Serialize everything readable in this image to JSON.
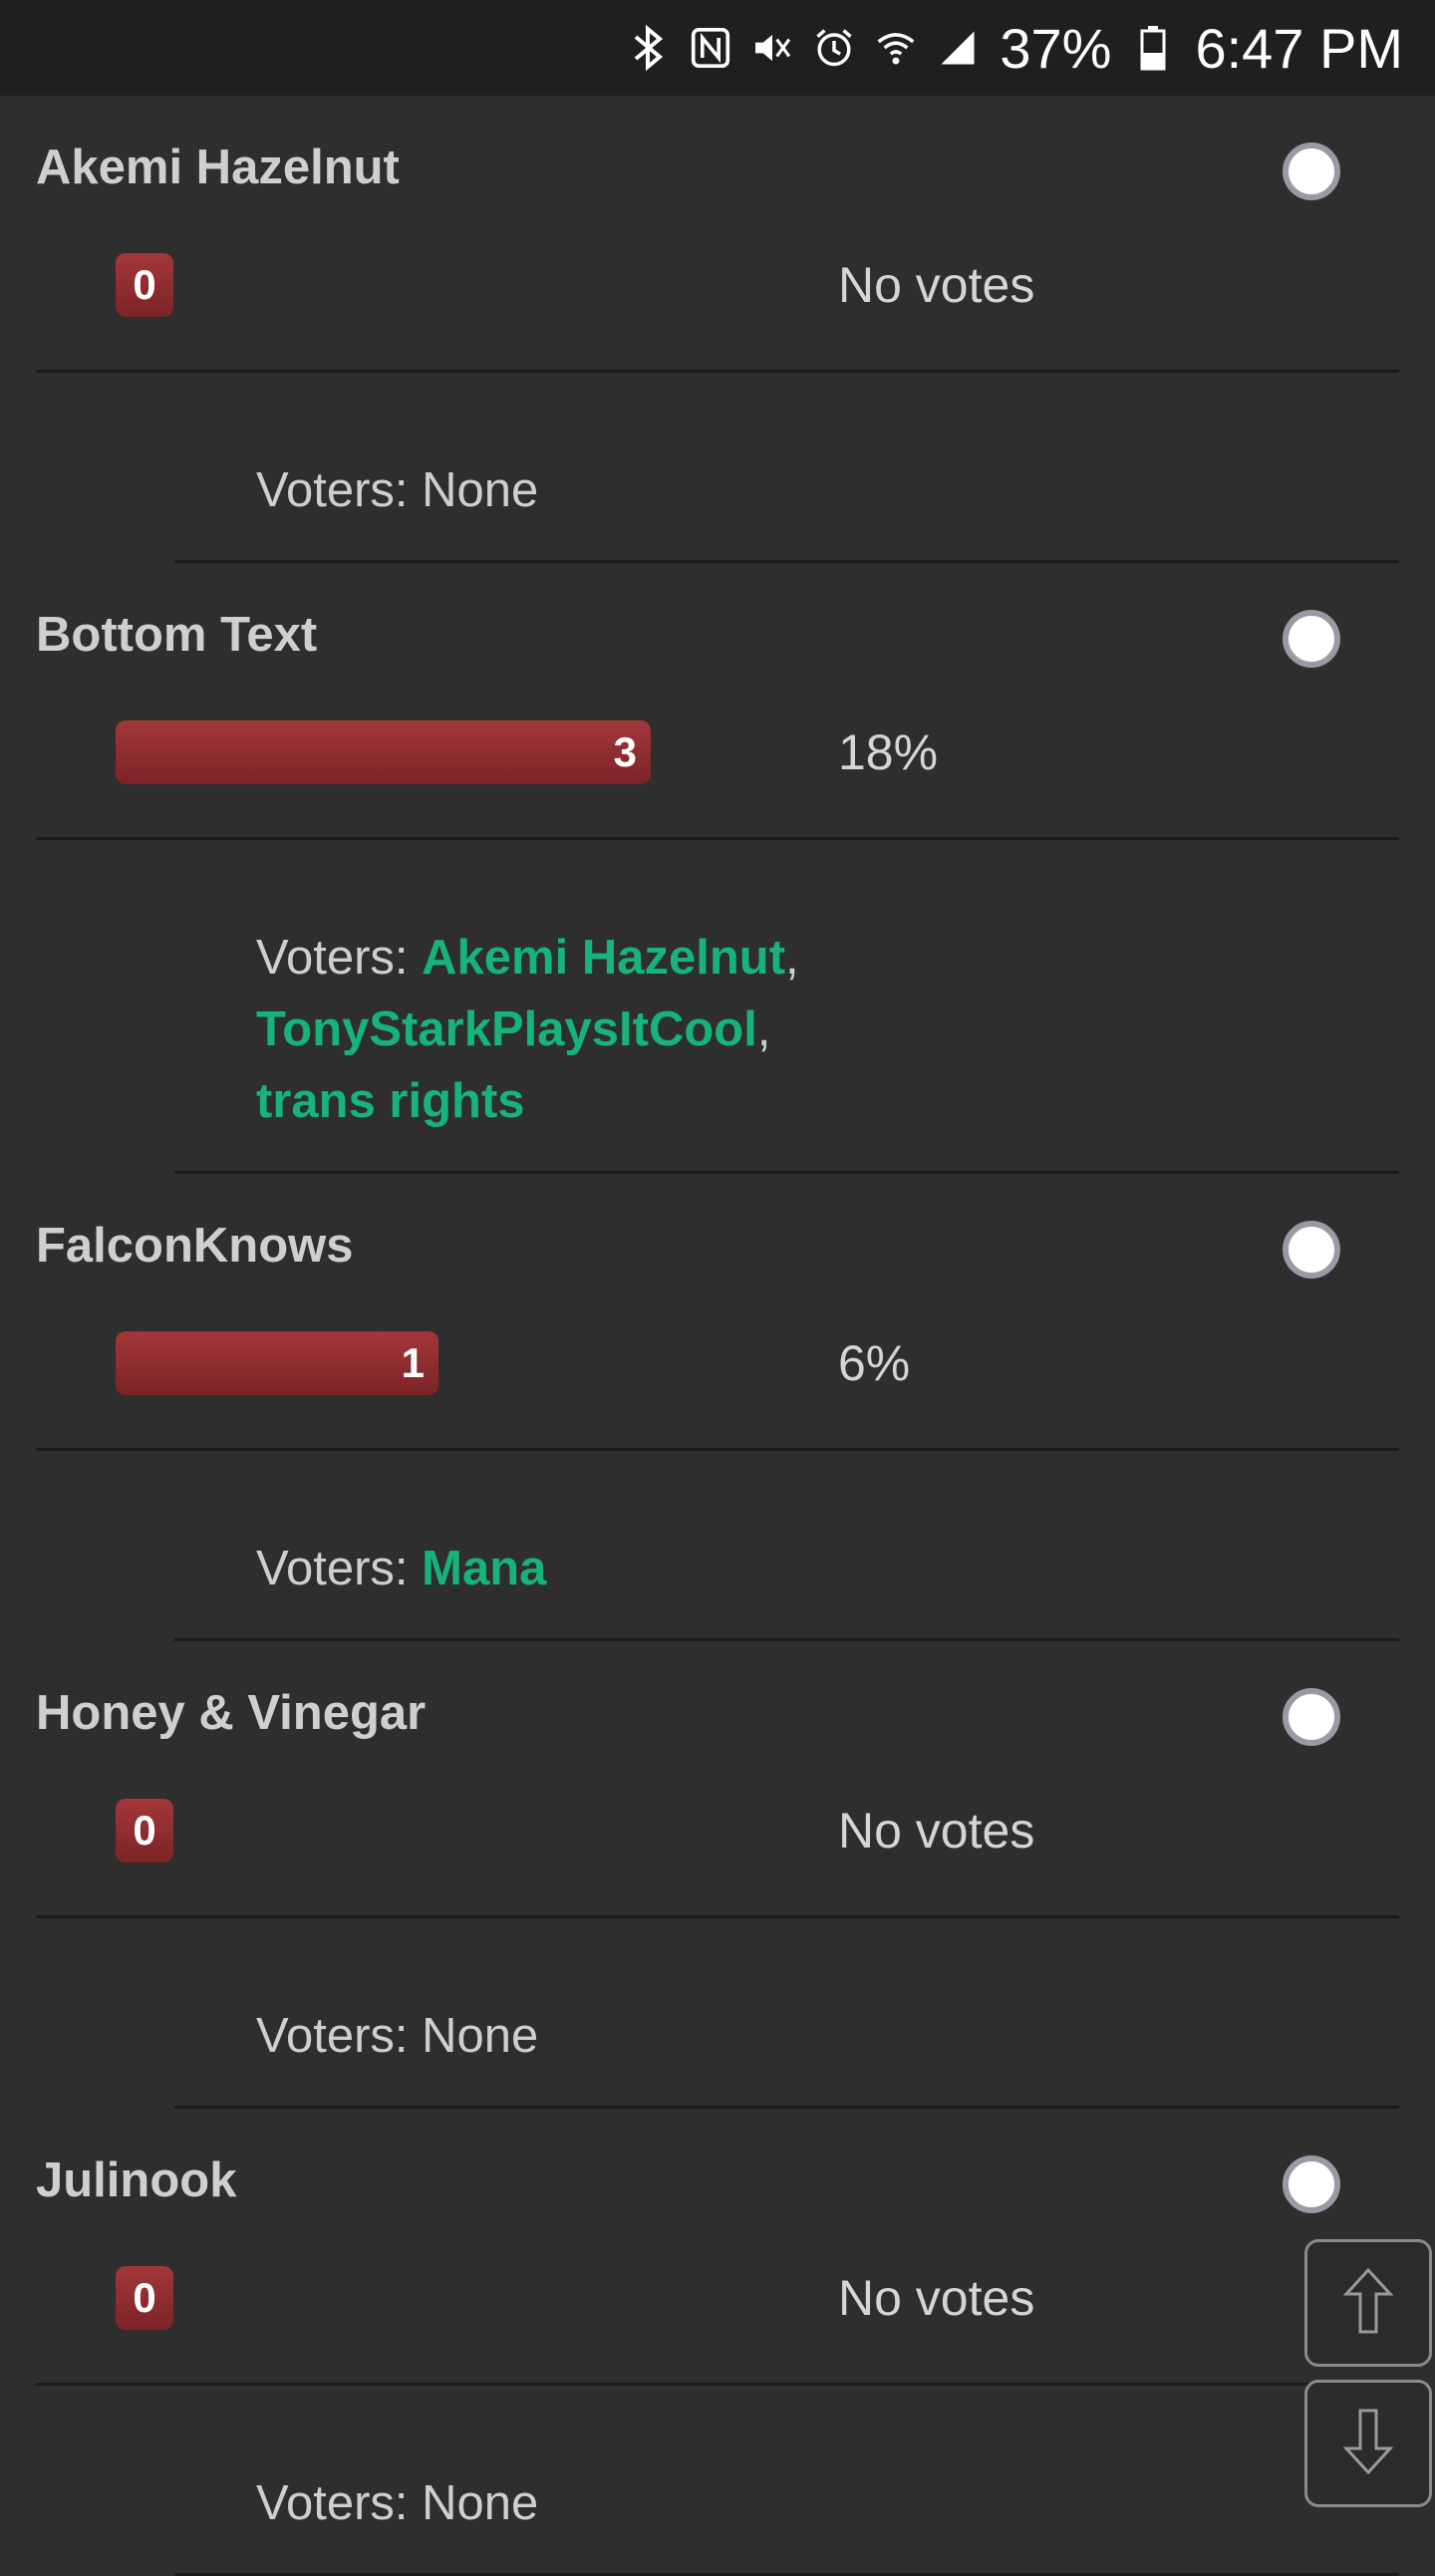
{
  "status_bar": {
    "battery": "37%",
    "time": "6:47 PM",
    "icons": [
      "bluetooth-icon",
      "nfc-icon",
      "mute-icon",
      "alarm-icon",
      "wifi-icon",
      "signal-icon",
      "battery-icon"
    ]
  },
  "options": [
    {
      "name": "Akemi Hazelnut",
      "votes": "0",
      "fraction": 0,
      "percent_label": "No votes",
      "voters_label": "Voters:",
      "voters_none": "None",
      "voters": []
    },
    {
      "name": "Bottom Text",
      "votes": "3",
      "fraction": 0.18,
      "percent_label": "18%",
      "voters_label": "Voters:",
      "voters_none": "",
      "voters": [
        "Akemi Hazelnut",
        "TonyStarkPlaysItCool",
        "trans rights"
      ]
    },
    {
      "name": "FalconKnows",
      "votes": "1",
      "fraction": 0.06,
      "percent_label": "6%",
      "voters_label": "Voters:",
      "voters_none": "",
      "voters": [
        "Mana"
      ]
    },
    {
      "name": "Honey & Vinegar",
      "votes": "0",
      "fraction": 0,
      "percent_label": "No votes",
      "voters_label": "Voters:",
      "voters_none": "None",
      "voters": []
    },
    {
      "name": "Julinook",
      "votes": "0",
      "fraction": 0,
      "percent_label": "No votes",
      "voters_label": "Voters:",
      "voters_none": "None",
      "voters": []
    }
  ],
  "colors": {
    "background": "#2e2e2e",
    "bar": "#952f32",
    "voter_link": "#17b37b"
  },
  "scroll_buttons": {
    "up_icon": "arrow-up-icon",
    "down_icon": "arrow-down-icon"
  }
}
